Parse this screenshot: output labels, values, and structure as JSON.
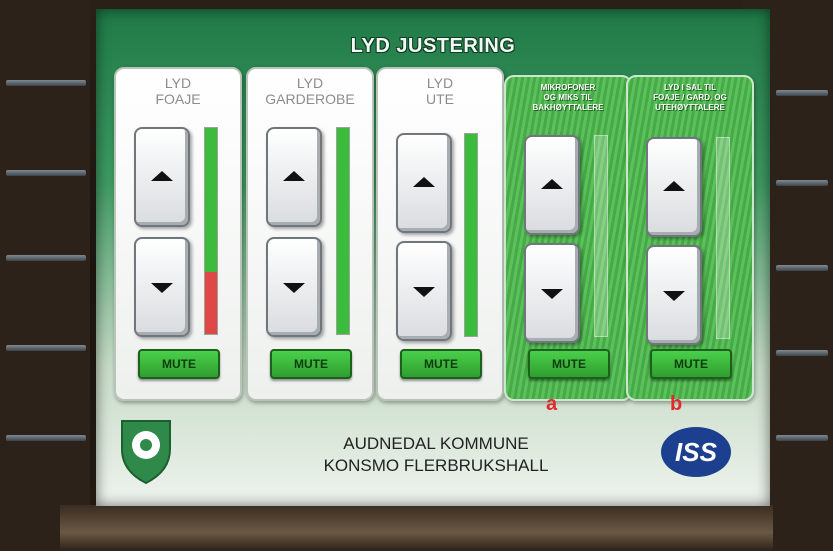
{
  "screen": {
    "title": "LYD JUSTERING",
    "panels": [
      {
        "label": "LYD\nFOAJE",
        "mute_label": "MUTE",
        "level_green": 1.0,
        "level_red": 0.3
      },
      {
        "label": "LYD\nGARDEROBE",
        "mute_label": "MUTE",
        "level_green": 1.0,
        "level_red": 0
      },
      {
        "label": "LYD\nUTE",
        "mute_label": "MUTE",
        "level_green": 1.0,
        "level_red": 0
      },
      {
        "label": "MIKROFONER\nOG MIKS TIL\nBAKHØYTTALERE",
        "mute_label": "MUTE",
        "marker": "a"
      },
      {
        "label": "LYD I SAL TIL\nFOAJE / GARD. OG\nUTEHØYTTALERE",
        "mute_label": "MUTE",
        "marker": "b"
      }
    ],
    "footer": {
      "line1": "AUDNEDAL KOMMUNE",
      "line2": "KONSMO FLERBRUKSHALL",
      "logo_text": "ISS"
    },
    "colors": {
      "meter_green": "#3dbb3d",
      "meter_red": "#e04848",
      "mute_green": "#3ab83a",
      "marker_red": "#e22a2a",
      "iss_blue": "#1d3f8f"
    },
    "icons": [
      "arrow-up-icon",
      "arrow-down-icon",
      "municipal-crest-icon",
      "iss-logo"
    ]
  }
}
